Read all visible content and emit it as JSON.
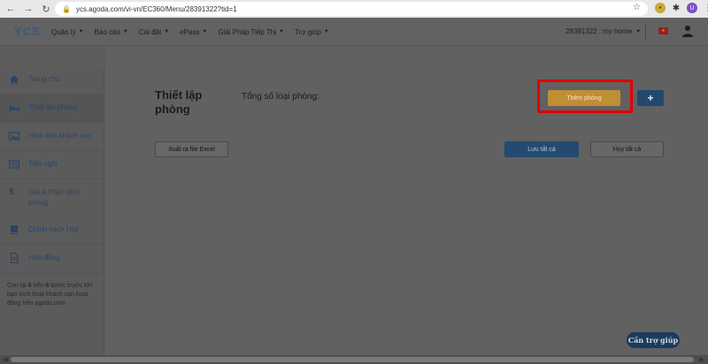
{
  "browser": {
    "url": "ycs.agoda.com/vi-vn/EC360/Menu/28391322?tid=1"
  },
  "header": {
    "logo": "YCS",
    "menu": [
      {
        "label": "Quản lý"
      },
      {
        "label": "Báo cáo"
      },
      {
        "label": "Cài đặt"
      },
      {
        "label": "ePass"
      },
      {
        "label": "Giải Pháp Tiếp Thị"
      },
      {
        "label": "Trợ giúp"
      }
    ],
    "account": "28391322 : my home"
  },
  "sidebar": {
    "items": [
      {
        "label": "Trang chủ",
        "icon": "home-icon"
      },
      {
        "label": "Thiết lập phòng",
        "icon": "bed-icon"
      },
      {
        "label": "Hình ảnh khách sạn",
        "icon": "image-icon"
      },
      {
        "label": "Tiện nghi",
        "icon": "list-icon"
      },
      {
        "label": "Giá & Phân phối phòng",
        "icon": "dollar-icon"
      },
      {
        "label": "Chính sách Hủy",
        "icon": "book-icon"
      },
      {
        "label": "Hợp đồng",
        "icon": "document-icon"
      }
    ],
    "note_prefix": "Còn lại ",
    "note_a": "6",
    "note_mid": " trên ",
    "note_b": "6",
    "note_suffix": " bước trước khi bạn kích hoạt khách sạn hoạt động trên agoda.com"
  },
  "main": {
    "title": "Thiết lập phòng",
    "total_label": "Tổng số loại phòng:",
    "add_room": "Thêm phòng",
    "plus": "+",
    "export_excel": "Xuất ra file Excel",
    "save_all": "Lưu tất cả",
    "cancel_all": "Hủy tất cả"
  },
  "help": {
    "label": "Cần trợ giúp"
  },
  "colors": {
    "highlight": "#e00000",
    "accent_orange": "#c08e35",
    "primary_blue": "#244a72"
  }
}
